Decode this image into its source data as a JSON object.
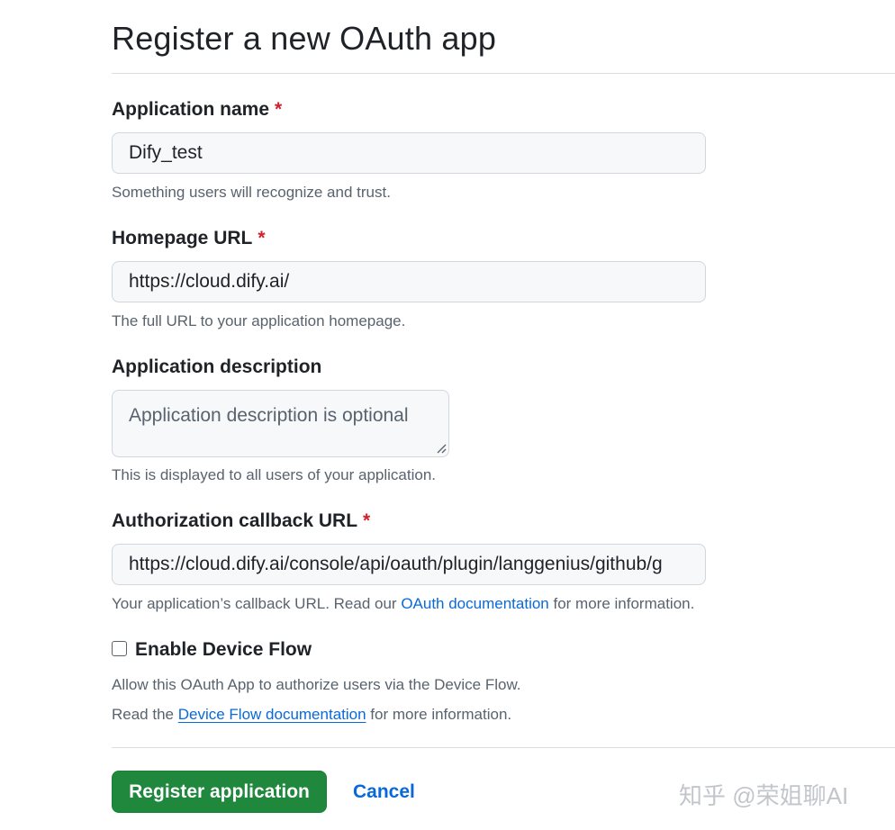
{
  "page": {
    "title": "Register a new OAuth app"
  },
  "required_mark": "*",
  "fields": {
    "app_name": {
      "label": "Application name",
      "value": "Dify_test",
      "hint": "Something users will recognize and trust."
    },
    "homepage_url": {
      "label": "Homepage URL",
      "value": "https://cloud.dify.ai/",
      "hint": "The full URL to your application homepage."
    },
    "description": {
      "label": "Application description",
      "placeholder": "Application description is optional",
      "hint": "This is displayed to all users of your application."
    },
    "callback_url": {
      "label": "Authorization callback URL",
      "value": "https://cloud.dify.ai/console/api/oauth/plugin/langgenius/github/g",
      "hint_before": "Your application’s callback URL. Read our",
      "hint_link": "OAuth documentation",
      "hint_after": "for more information."
    }
  },
  "device_flow": {
    "label": "Enable Device Flow",
    "checked": false,
    "hint_line1": "Allow this OAuth App to authorize users via the Device Flow.",
    "hint_line2_before": "Read the",
    "hint_line2_link": "Device Flow documentation",
    "hint_line2_after": "for more information."
  },
  "actions": {
    "register_label": "Register application",
    "cancel_label": "Cancel"
  },
  "watermark": "知乎 @荣姐聊AI",
  "colors": {
    "primary_button": "#1f883d",
    "link": "#0969da",
    "required": "#cf222e"
  }
}
